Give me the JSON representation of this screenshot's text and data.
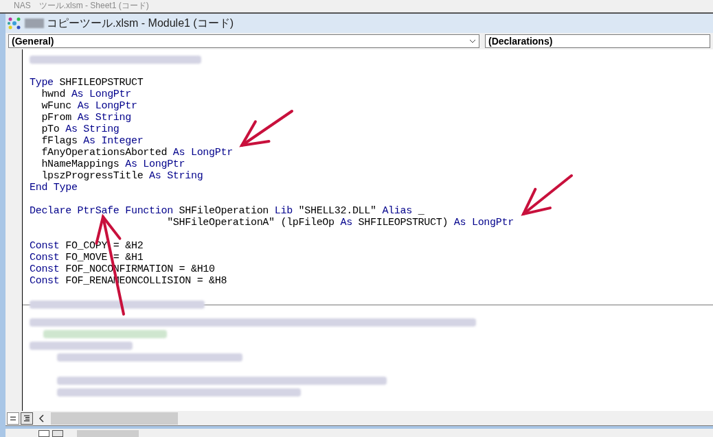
{
  "background_window": {
    "title_start": "NAS",
    "title_end": "ツール.xlsm - Sheet1 (コード)"
  },
  "window": {
    "title": "コピーツール.xlsm - Module1 (コード)"
  },
  "object_box": {
    "value": "(General)"
  },
  "procedure_box": {
    "value": "(Declarations)"
  },
  "upper_pane": [
    {
      "kind": "redacted"
    },
    {
      "kind": "blank"
    },
    {
      "kind": "code",
      "tokens": [
        {
          "text": "Type",
          "kind": "keyword"
        },
        {
          "text": " SHFILEOPSTRUCT",
          "kind": "plain"
        }
      ]
    },
    {
      "kind": "code",
      "tokens": [
        {
          "text": "  hwnd ",
          "kind": "plain"
        },
        {
          "text": "As LongPtr",
          "kind": "keyword"
        }
      ]
    },
    {
      "kind": "code",
      "tokens": [
        {
          "text": "  wFunc ",
          "kind": "plain"
        },
        {
          "text": "As LongPtr",
          "kind": "keyword"
        }
      ]
    },
    {
      "kind": "code",
      "tokens": [
        {
          "text": "  pFrom ",
          "kind": "plain"
        },
        {
          "text": "As String",
          "kind": "keyword"
        }
      ]
    },
    {
      "kind": "code",
      "tokens": [
        {
          "text": "  pTo ",
          "kind": "plain"
        },
        {
          "text": "As String",
          "kind": "keyword"
        }
      ]
    },
    {
      "kind": "code",
      "tokens": [
        {
          "text": "  fFlags ",
          "kind": "plain"
        },
        {
          "text": "As Integer",
          "kind": "keyword"
        }
      ]
    },
    {
      "kind": "code",
      "tokens": [
        {
          "text": "  fAnyOperationsAborted ",
          "kind": "plain"
        },
        {
          "text": "As LongPtr",
          "kind": "keyword"
        }
      ]
    },
    {
      "kind": "code",
      "tokens": [
        {
          "text": "  hNameMappings ",
          "kind": "plain"
        },
        {
          "text": "As LongPtr",
          "kind": "keyword"
        }
      ]
    },
    {
      "kind": "code",
      "tokens": [
        {
          "text": "  lpszProgressTitle ",
          "kind": "plain"
        },
        {
          "text": "As String",
          "kind": "keyword"
        }
      ]
    },
    {
      "kind": "code",
      "tokens": [
        {
          "text": "End Type",
          "kind": "keyword"
        }
      ]
    },
    {
      "kind": "blank"
    },
    {
      "kind": "code",
      "tokens": [
        {
          "text": "Declare PtrSafe Function",
          "kind": "keyword"
        },
        {
          "text": " SHFileOperation ",
          "kind": "plain"
        },
        {
          "text": "Lib",
          "kind": "keyword"
        },
        {
          "text": " \"SHELL32.DLL\" ",
          "kind": "plain"
        },
        {
          "text": "Alias",
          "kind": "keyword"
        },
        {
          "text": " _",
          "kind": "plain"
        }
      ]
    },
    {
      "kind": "code",
      "tokens": [
        {
          "text": "                       \"SHFileOperationA\" (lpFileOp ",
          "kind": "plain"
        },
        {
          "text": "As",
          "kind": "keyword"
        },
        {
          "text": " SHFILEOPSTRUCT) ",
          "kind": "plain"
        },
        {
          "text": "As LongPtr",
          "kind": "keyword"
        }
      ]
    },
    {
      "kind": "blank"
    },
    {
      "kind": "code",
      "tokens": [
        {
          "text": "Const",
          "kind": "keyword"
        },
        {
          "text": " FO_COPY = &H2",
          "kind": "plain"
        }
      ]
    },
    {
      "kind": "code",
      "tokens": [
        {
          "text": "Const",
          "kind": "keyword"
        },
        {
          "text": " FO_MOVE = &H1",
          "kind": "plain"
        }
      ]
    },
    {
      "kind": "code",
      "tokens": [
        {
          "text": "Const",
          "kind": "keyword"
        },
        {
          "text": " FOF_NOCONFIRMATION = &H10",
          "kind": "plain"
        }
      ]
    },
    {
      "kind": "code",
      "tokens": [
        {
          "text": "Const",
          "kind": "keyword"
        },
        {
          "text": " FOF_RENAMEONCOLLISION = &H8",
          "kind": "plain"
        }
      ]
    },
    {
      "kind": "blank"
    },
    {
      "kind": "redacted"
    }
  ],
  "lower_pane": [
    {
      "kind": "redacted"
    },
    {
      "kind": "redacted_comment"
    },
    {
      "kind": "redacted"
    },
    {
      "kind": "redacted"
    },
    {
      "kind": "blank"
    },
    {
      "kind": "redacted"
    },
    {
      "kind": "redacted"
    }
  ]
}
